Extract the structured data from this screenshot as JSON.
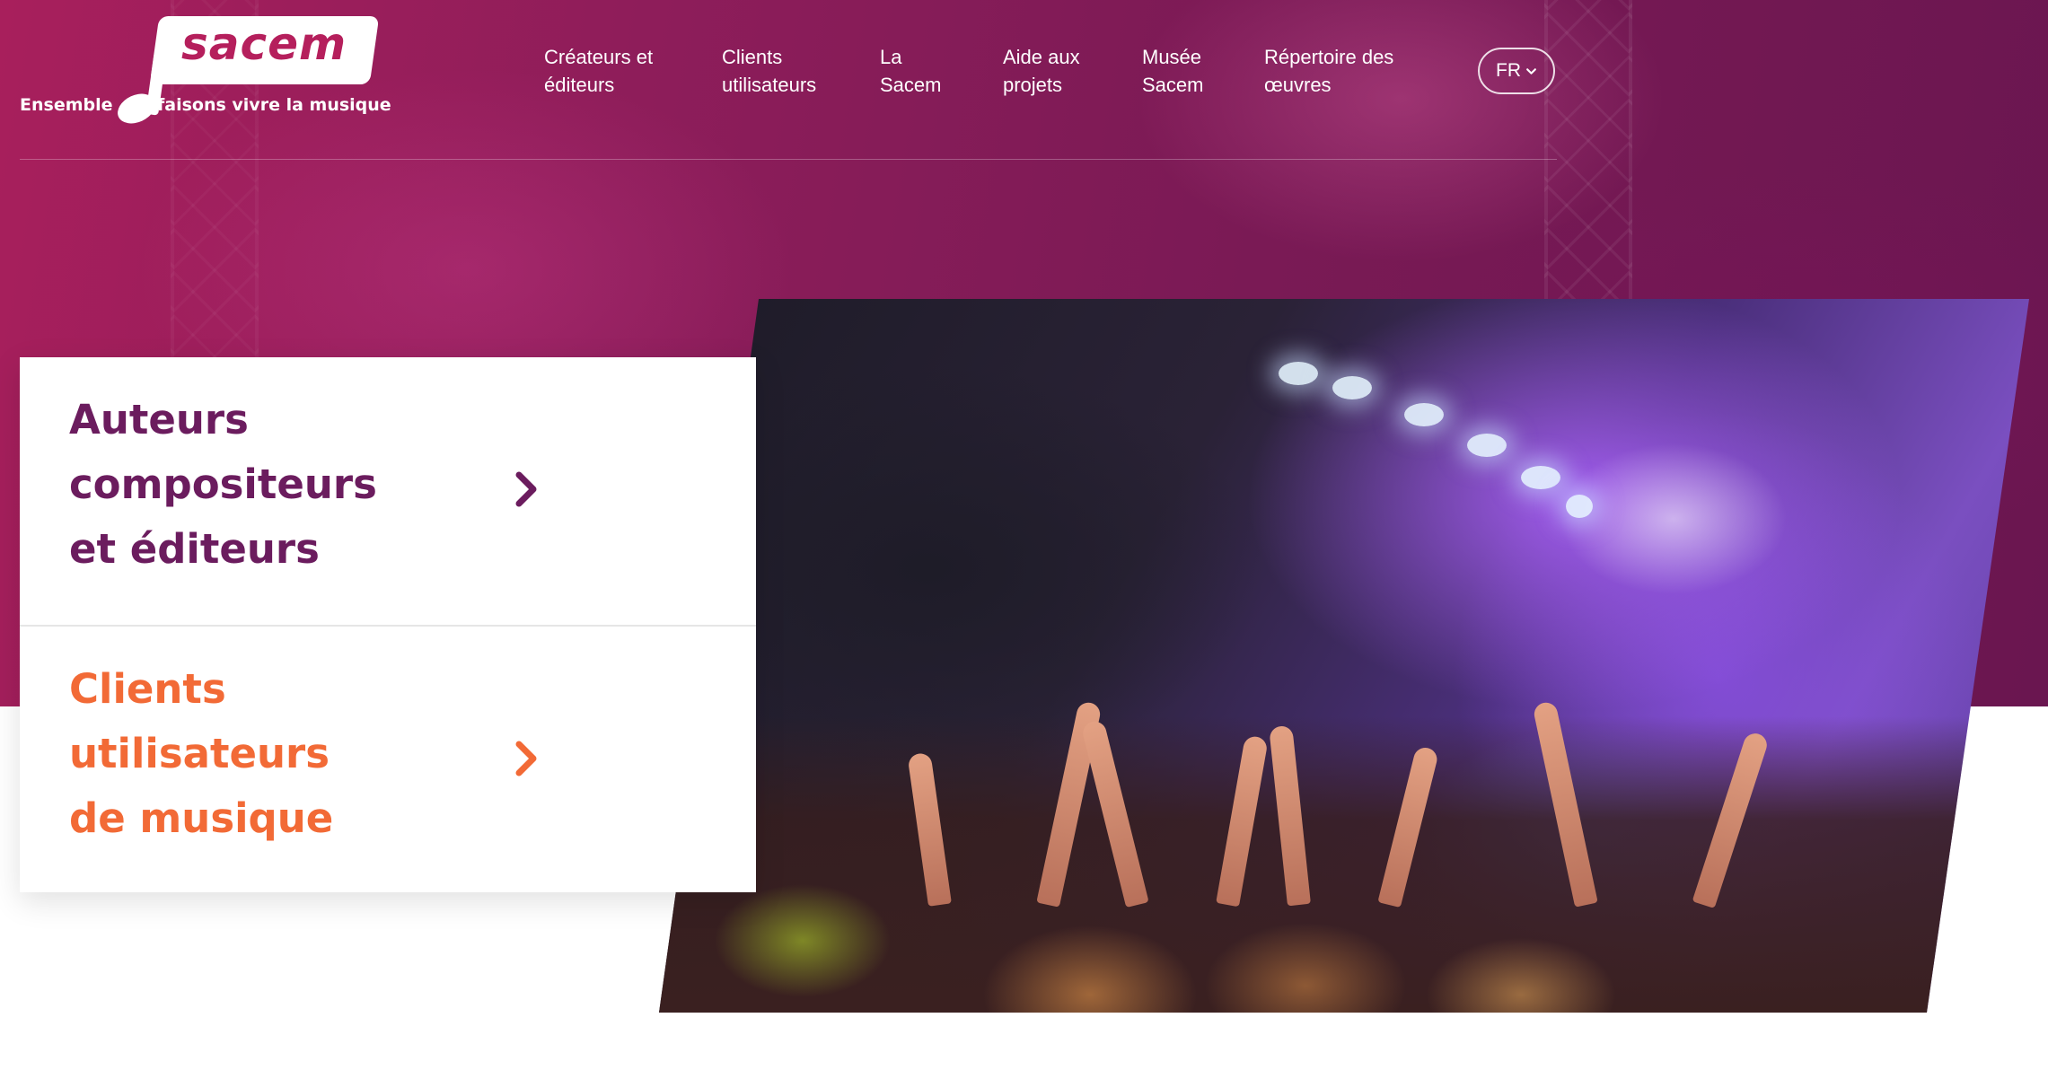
{
  "brand": {
    "name": "sacem",
    "tagline_left": "Ensemble",
    "tagline_right": "faisons vivre la musique"
  },
  "nav": {
    "items": [
      {
        "label": "Créateurs et\néditeurs"
      },
      {
        "label": "Clients\nutilisateurs"
      },
      {
        "label": "La\nSacem"
      },
      {
        "label": "Aide aux\nprojets"
      },
      {
        "label": "Musée\nSacem"
      },
      {
        "label": "Répertoire des\nœuvres"
      }
    ],
    "language": "FR"
  },
  "categories": [
    {
      "title": "Auteurs\ncompositeurs\net éditeurs",
      "color": "#6b1c5e"
    },
    {
      "title": "Clients\nutilisateurs\nde musique",
      "color": "#f26a36"
    }
  ],
  "colors": {
    "hero_background": "#8e1d5a",
    "brand_accent": "#b51f5c",
    "category_primary": "#6b1c5e",
    "category_secondary": "#f26a36"
  },
  "icons": {
    "category_arrow": "chevron-right-icon",
    "language_caret": "chevron-down-icon"
  }
}
